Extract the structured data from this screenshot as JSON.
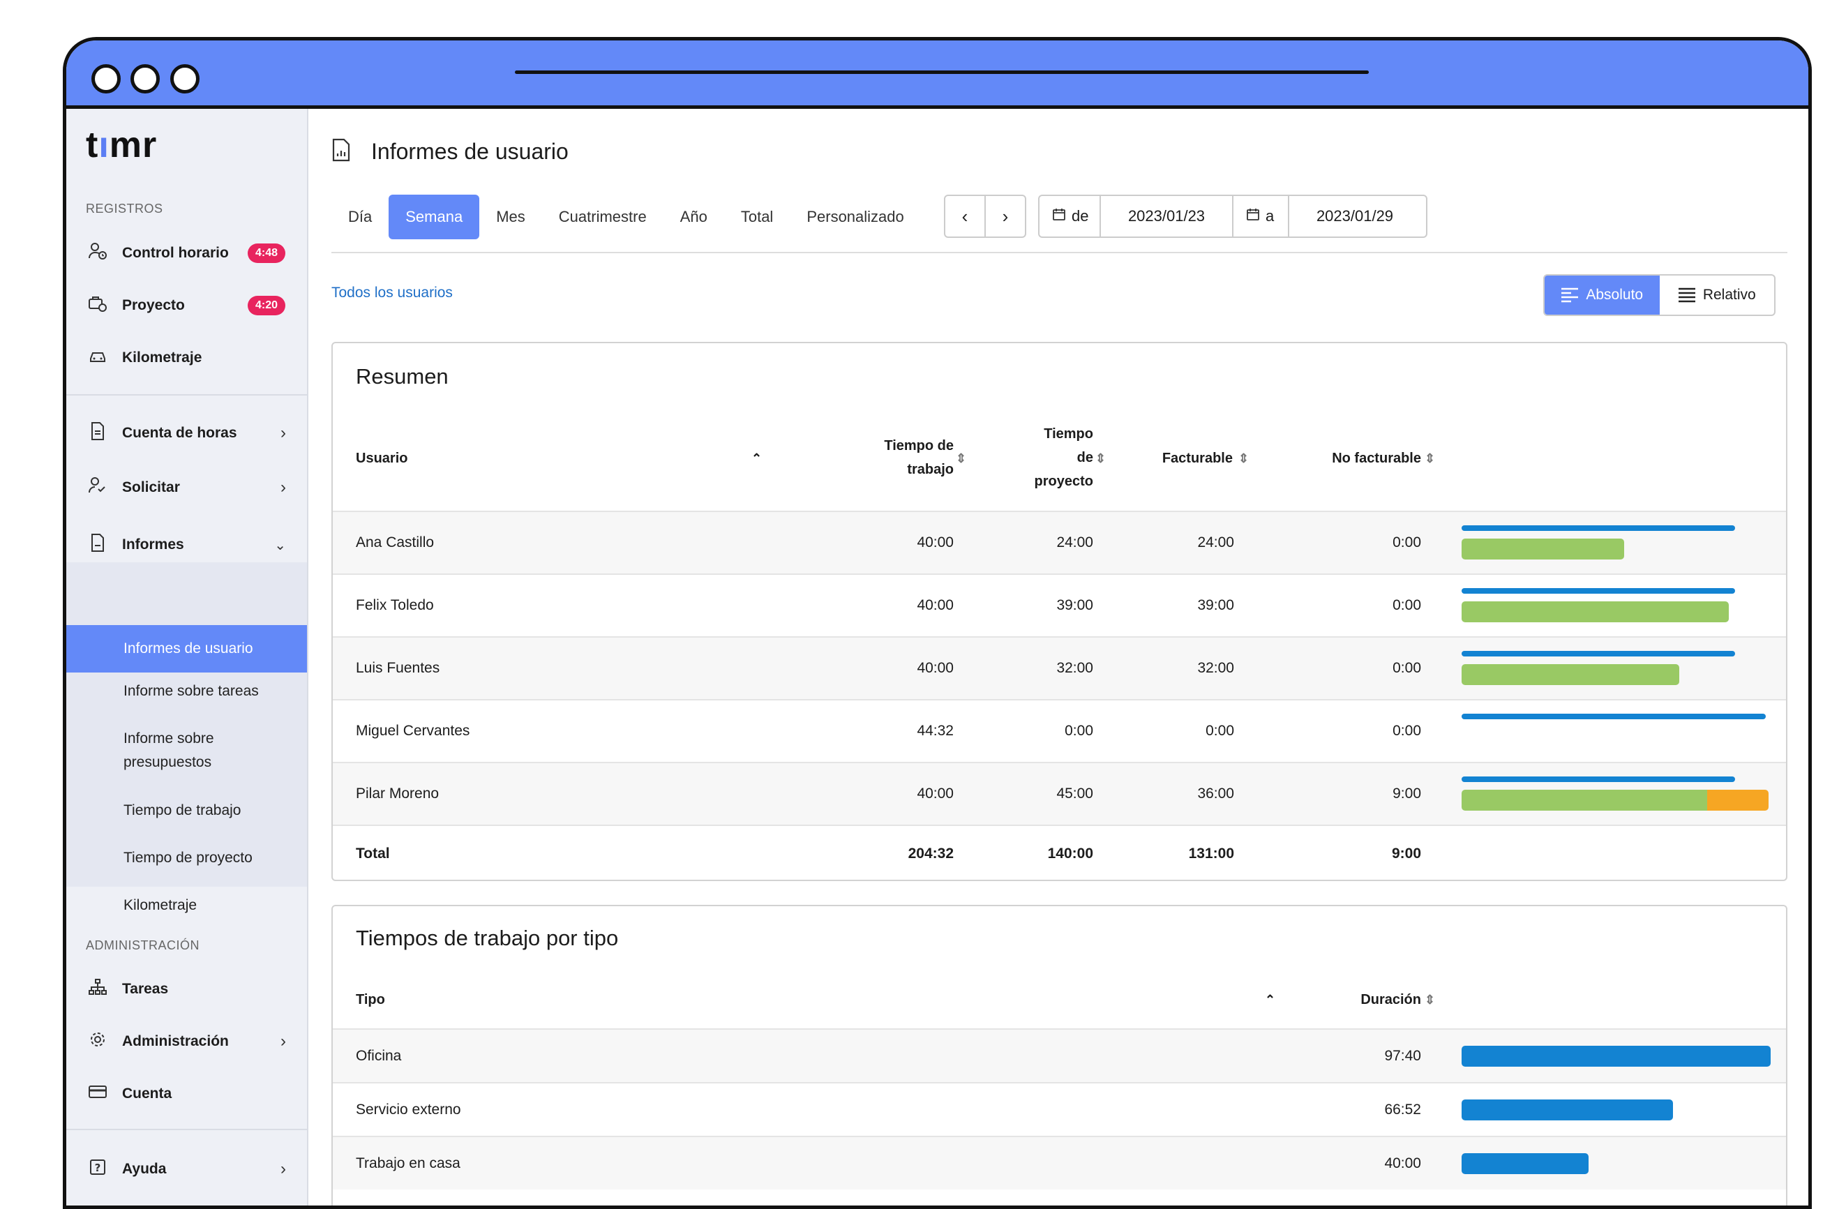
{
  "sidebar": {
    "logo": {
      "t": "t",
      "i": "ı",
      "rest": "mr"
    },
    "registros_title": "REGISTROS",
    "control_horario": {
      "label": "Control horario",
      "badge": "4:48"
    },
    "proyecto": {
      "label": "Proyecto",
      "badge": "4:20"
    },
    "kilometraje": "Kilometraje",
    "cuenta_horas": "Cuenta de horas",
    "solicitar": "Solicitar",
    "informes": "Informes",
    "sub": {
      "usuario": "Informes de usuario",
      "tareas": "Informe sobre tareas",
      "presupuestos": "Informe sobre presupuestos",
      "trabajo": "Tiempo de trabajo",
      "proyecto": "Tiempo de proyecto",
      "kilometraje": "Kilometraje"
    },
    "admin_title": "ADMINISTRACIÓN",
    "tareas": "Tareas",
    "administracion": "Administración",
    "cuenta": "Cuenta",
    "ayuda": "Ayuda"
  },
  "main": {
    "title": "Informes de usuario",
    "tabs": [
      "Día",
      "Semana",
      "Mes",
      "Cuatrimestre",
      "Año",
      "Total",
      "Personalizado"
    ],
    "active_tab": "Semana",
    "date_from_label": "de",
    "date_from": "2023/01/23",
    "date_to_label": "a",
    "date_to": "2023/01/29",
    "all_users": "Todos los usuarios",
    "toggle_abs": "Absoluto",
    "toggle_rel": "Relativo"
  },
  "summary": {
    "title": "Resumen",
    "headers": {
      "usuario": "Usuario",
      "tiempo_trabajo_1": "Tiempo de",
      "tiempo_trabajo_2": "trabajo",
      "tiempo_proyecto_1": "Tiempo",
      "tiempo_proyecto_2": "de",
      "tiempo_proyecto_3": "proyecto",
      "facturable": "Facturable",
      "no_facturable": "No facturable"
    },
    "rows": [
      {
        "name": "Ana Castillo",
        "trabajo": "40:00",
        "proyecto": "24:00",
        "facturable": "24:00",
        "no_facturable": "0:00",
        "blue": 0.89,
        "green": 0.53,
        "orange": 0
      },
      {
        "name": "Felix Toledo",
        "trabajo": "40:00",
        "proyecto": "39:00",
        "facturable": "39:00",
        "no_facturable": "0:00",
        "blue": 0.89,
        "green": 0.87,
        "orange": 0
      },
      {
        "name": "Luis Fuentes",
        "trabajo": "40:00",
        "proyecto": "32:00",
        "facturable": "32:00",
        "no_facturable": "0:00",
        "blue": 0.89,
        "green": 0.71,
        "orange": 0
      },
      {
        "name": "Miguel Cervantes",
        "trabajo": "44:32",
        "proyecto": "0:00",
        "facturable": "0:00",
        "no_facturable": "0:00",
        "blue": 0.99,
        "green": 0,
        "orange": 0
      },
      {
        "name": "Pilar Moreno",
        "trabajo": "40:00",
        "proyecto": "45:00",
        "facturable": "36:00",
        "no_facturable": "9:00",
        "blue": 0.89,
        "green": 0.8,
        "orange": 0.2
      }
    ],
    "total": {
      "label": "Total",
      "trabajo": "204:32",
      "proyecto": "140:00",
      "facturable": "131:00",
      "no_facturable": "9:00"
    }
  },
  "tipos": {
    "title": "Tiempos de trabajo por tipo",
    "headers": {
      "tipo": "Tipo",
      "duracion": "Duración"
    },
    "rows": [
      {
        "tipo": "Oficina",
        "duracion": "97:40",
        "fraction": 1.0
      },
      {
        "tipo": "Servicio externo",
        "duracion": "66:52",
        "fraction": 0.685
      },
      {
        "tipo": "Trabajo en casa",
        "duracion": "40:00",
        "fraction": 0.41
      }
    ]
  },
  "colors": {
    "accent": "#6389f8",
    "blue_bar": "#1383d2",
    "green_bar": "#99c964",
    "orange_bar": "#f6a623",
    "badge": "#e8245e",
    "link": "#1f6fc7"
  }
}
